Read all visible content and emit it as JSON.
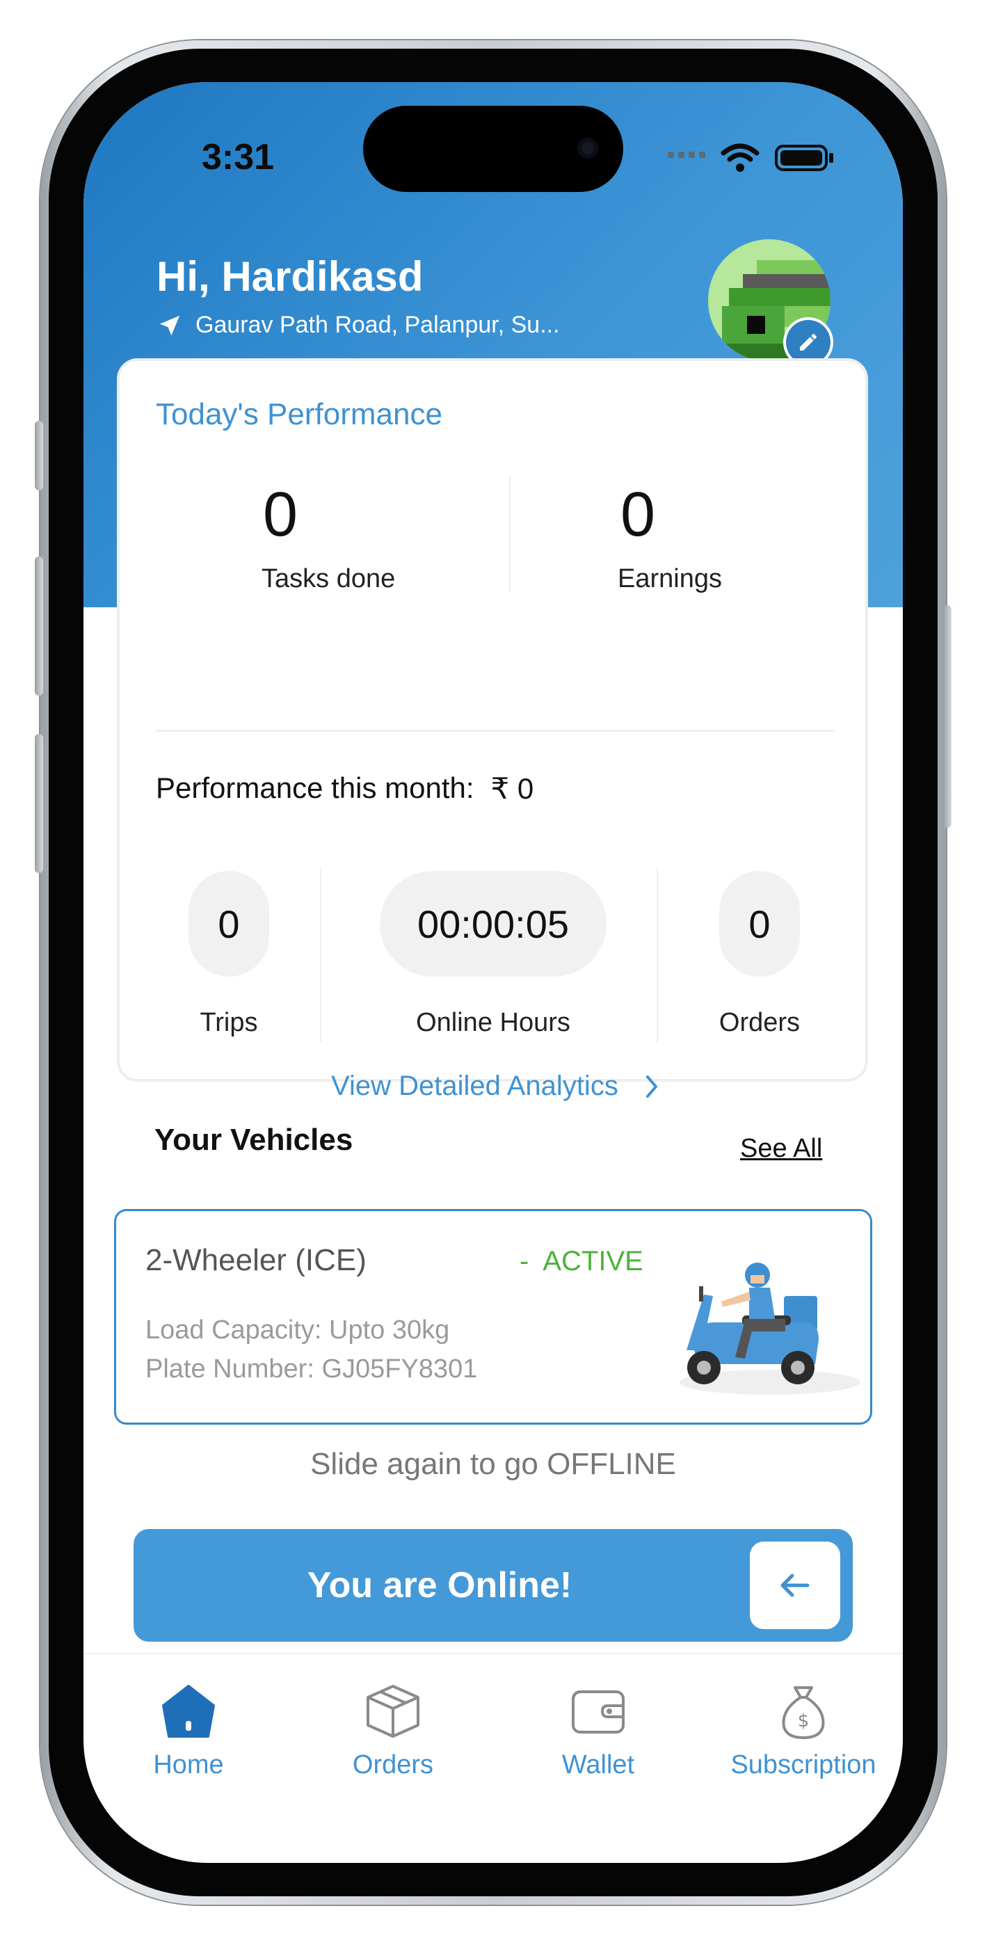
{
  "status_bar": {
    "time": "3:31",
    "icons": [
      "signal-icon",
      "wifi-icon",
      "battery-icon"
    ]
  },
  "header": {
    "greeting": "Hi, Hardikasd",
    "location": "Gaurav Path Road, Palanpur, Su...",
    "location_icon": "navigation-arrow-icon",
    "avatar_edit_icon": "pencil-icon"
  },
  "performance": {
    "title": "Today's Performance",
    "tasks_done_value": "0",
    "tasks_done_label": "Tasks done",
    "earnings_value": "0",
    "earnings_label": "Earnings",
    "month_label": "Performance this month:",
    "month_value": "₹ 0",
    "stats": [
      {
        "value": "0",
        "label": "Trips"
      },
      {
        "value": "00:00:05",
        "label": "Online Hours"
      },
      {
        "value": "0",
        "label": "Orders"
      }
    ],
    "analytics_link": "View Detailed Analytics"
  },
  "vehicles": {
    "title": "Your Vehicles",
    "see_all": "See All",
    "items": [
      {
        "name": "2-Wheeler (ICE)",
        "status": "-  ACTIVE",
        "load_capacity": "Load Capacity: Upto 30kg",
        "plate_number": "Plate Number: GJ05FY8301"
      }
    ]
  },
  "slider": {
    "hint": "Slide again to go OFFLINE",
    "label": "You are Online!",
    "thumb_icon": "arrow-left-icon"
  },
  "tabbar": {
    "items": [
      {
        "label": "Home",
        "icon": "home-icon"
      },
      {
        "label": "Orders",
        "icon": "box-icon"
      },
      {
        "label": "Wallet",
        "icon": "wallet-icon"
      },
      {
        "label": "Subscription",
        "icon": "money-bag-icon"
      }
    ]
  },
  "colors": {
    "accent": "#3f92d2",
    "active_green": "#4db23a",
    "header_blue": "#2f86cc"
  }
}
